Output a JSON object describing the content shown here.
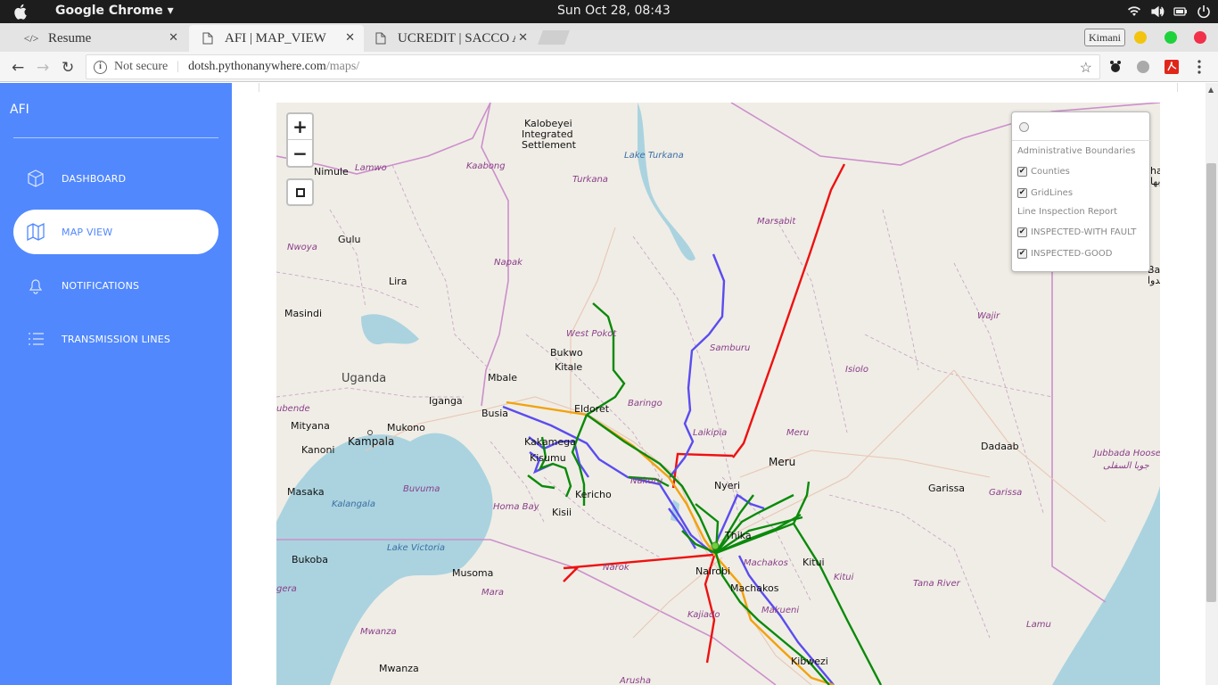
{
  "system_bar": {
    "app_name": "Google Chrome ▾",
    "clock": "Sun Oct 28, 08:43",
    "tray_icons": [
      "wifi-icon",
      "volume-icon",
      "battery-icon",
      "power-icon"
    ]
  },
  "tabs": [
    {
      "label": "Resume",
      "icon": "code-icon",
      "state": "inactive"
    },
    {
      "label": "AFI | MAP_VIEW",
      "icon": "page-icon",
      "state": "active"
    },
    {
      "label": "UCREDIT | SACCO AC",
      "icon": "page-icon",
      "state": "inactive"
    }
  ],
  "browser": {
    "profile_name": "Kimani",
    "security_label": "Not secure",
    "url_host": "dotsh.pythonanywhere.com",
    "url_path": "/maps/"
  },
  "sidebar": {
    "brand": "AFI",
    "items": [
      {
        "label": "DASHBOARD",
        "icon": "cube-icon",
        "active": false
      },
      {
        "label": "MAP VIEW",
        "icon": "map-icon",
        "active": true
      },
      {
        "label": "NOTIFICATIONS",
        "icon": "bell-icon",
        "active": false
      },
      {
        "label": "TRANSMISSION LINES",
        "icon": "list-icon",
        "active": false
      }
    ]
  },
  "map": {
    "zoom_in": "+",
    "zoom_out": "−",
    "layer_control": {
      "group1_title": "Administrative Boundaries",
      "group2_title": "Line Inspection Report",
      "layers": [
        {
          "label": "Counties",
          "checked": true
        },
        {
          "label": "GridLines",
          "checked": true
        },
        {
          "label": "INSPECTED-WITH FAULT",
          "checked": true
        },
        {
          "label": "INSPECTED-GOOD",
          "checked": true
        }
      ]
    },
    "labels": {
      "kalobeyei": "Kalobeyei",
      "integrated": "Integrated",
      "settlement": "Settlement",
      "lake_turkana": "Lake Turkana",
      "nimule": "Nimule",
      "lamwo": "Lamwo",
      "kaabong": "Kaabong",
      "turkana": "Turkana",
      "marsabit": "Marsabit",
      "gulu": "Gulu",
      "nwoya": "Nwoya",
      "napak": "Napak",
      "lira": "Lira",
      "masindi": "Masindi",
      "wajir": "Wajir",
      "west_pokot": "West Pokot",
      "bukwo": "Bukwo",
      "kitale": "Kitale",
      "samburu": "Samburu",
      "uganda": "Uganda",
      "mbale": "Mbale",
      "isiolo": "Isiolo",
      "iganga": "Iganga",
      "eldoret": "Eldoret",
      "baringo": "Baringo",
      "busia": "Busia",
      "ubende": "ubende",
      "mityana": "Mityana",
      "mukono": "Mukono",
      "laikipia": "Laikipia",
      "meru_region": "Meru",
      "kampala": "Kampala",
      "kakamega": "Kakamega",
      "meru_city": "Meru",
      "dadaab": "Dadaab",
      "kanoni": "Kanoni",
      "kisumu": "Kisumu",
      "nyeri": "Nyeri",
      "nakuru": "Nakuru",
      "kericho": "Kericho",
      "garissa_city": "Garissa",
      "garissa_region": "Garissa",
      "masaka": "Masaka",
      "buvuma": "Buvuma",
      "kalangala": "Kalangala",
      "homa_bay": "Homa Bay",
      "kisii": "Kisii",
      "thika": "Thika",
      "lake_victoria": "Lake Victoria",
      "bukoba": "Bukoba",
      "narok": "Narok",
      "machakos_region": "Machakos",
      "kitui_city": "Kitui",
      "musoma": "Musoma",
      "nairobi": "Nairobi",
      "kitui_region": "Kitui",
      "tana_river": "Tana River",
      "gera": "gera",
      "mara": "Mara",
      "machakos_city": "Machakos",
      "kajiado": "Kajiado",
      "makueni": "Makueni",
      "lamu": "Lamu",
      "mwanza_region": "Mwanza",
      "kibwezi": "Kibwezi",
      "mwanza_city": "Mwanza",
      "arusha": "Arusha",
      "jubbada_hoose": "Jubbada Hoose",
      "jubbada_arabic": "جوبا السفلى",
      "baardi": "Baardh",
      "baardi_arabic": "بيدوا",
      "edge_ha": "ha",
      "edge_ha_arabic": "بها"
    },
    "line_colors": {
      "fault": "#ee1111",
      "good": "#0a8a0a",
      "grid": "#5a4cf0",
      "orange": "#f2a20c"
    }
  }
}
